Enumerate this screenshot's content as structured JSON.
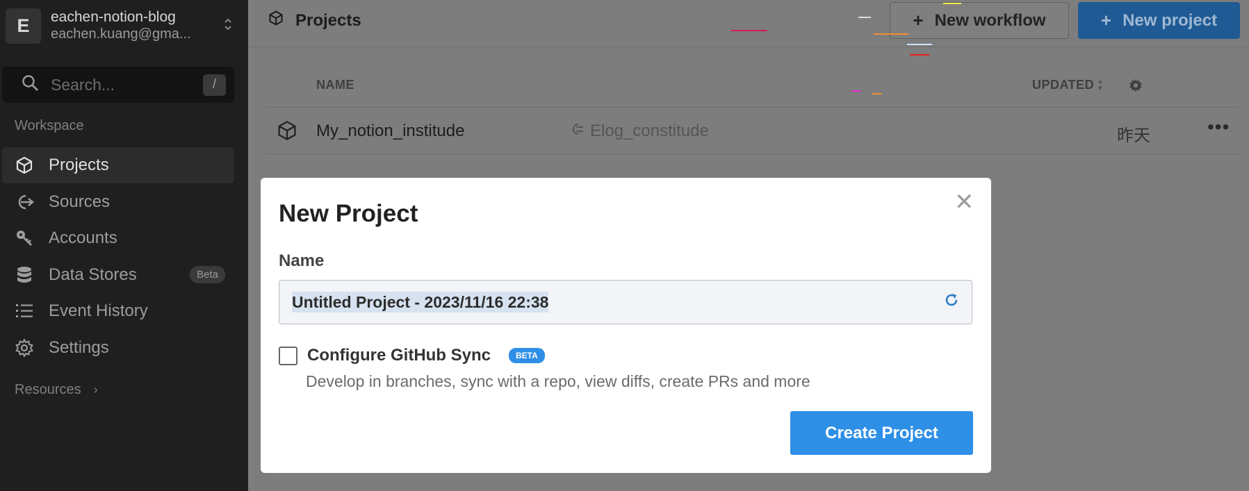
{
  "workspace": {
    "initial": "E",
    "name": "eachen-notion-blog",
    "email": "eachen.kuang@gma..."
  },
  "search": {
    "placeholder": "Search...",
    "shortcut": "/"
  },
  "sidebar": {
    "section_title": "Workspace",
    "items": [
      {
        "label": "Projects",
        "icon": "cube-icon",
        "active": true
      },
      {
        "label": "Sources",
        "icon": "source-arrow-icon"
      },
      {
        "label": "Accounts",
        "icon": "key-icon"
      },
      {
        "label": "Data Stores",
        "icon": "database-icon",
        "badge": "Beta"
      },
      {
        "label": "Event History",
        "icon": "list-icon"
      },
      {
        "label": "Settings",
        "icon": "gear-icon"
      }
    ],
    "resources_label": "Resources"
  },
  "header": {
    "title": "Projects",
    "new_workflow_label": "New workflow",
    "new_project_label": "New project"
  },
  "table": {
    "columns": {
      "name": "NAME",
      "updated": "UPDATED"
    },
    "rows": [
      {
        "name": "My_notion_institude",
        "source": "Elog_constitude",
        "updated": "昨天"
      }
    ]
  },
  "modal": {
    "title": "New Project",
    "name_label": "Name",
    "name_value": "Untitled Project - 2023/11/16 22:38",
    "github_sync_label": "Configure GitHub Sync",
    "beta_badge": "BETA",
    "github_sync_desc": "Develop in branches, sync with a repo, view diffs, create PRs and more",
    "create_button": "Create Project"
  },
  "colors": {
    "primary": "#2e8fe7",
    "sidebar_bg": "#1f1f1f"
  }
}
